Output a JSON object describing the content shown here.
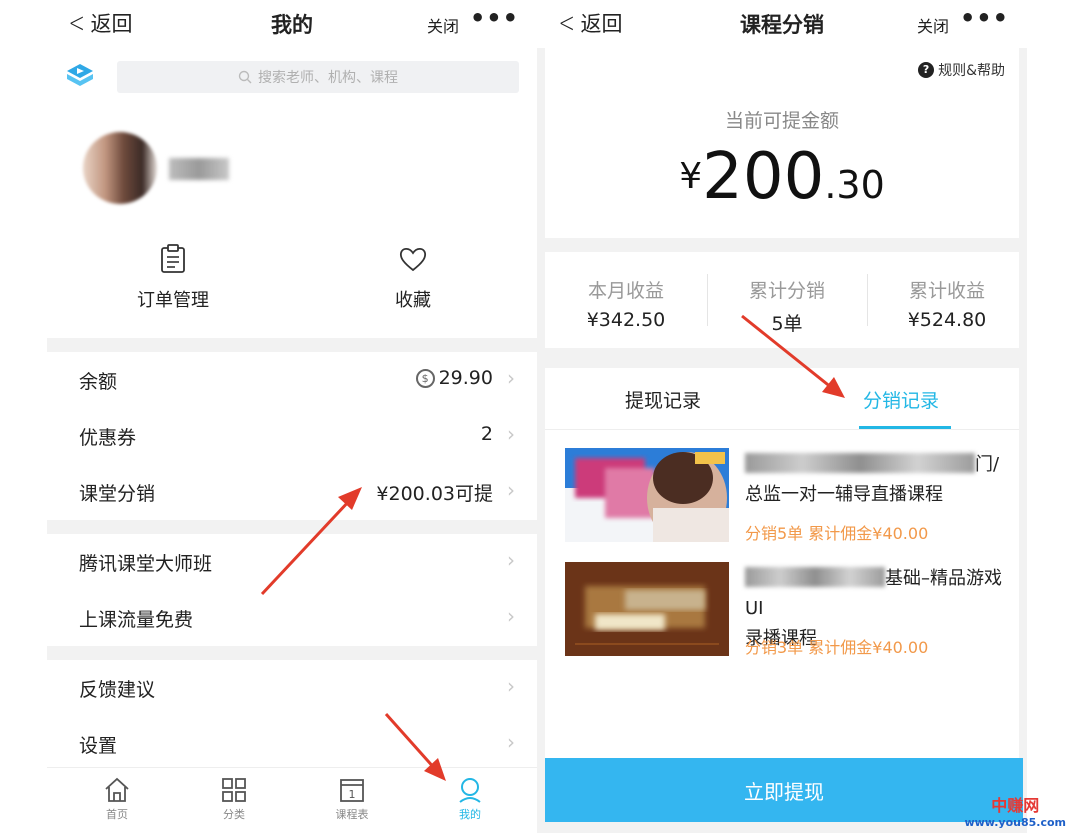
{
  "left": {
    "nav": {
      "back": "返回",
      "title": "我的",
      "close": "关闭",
      "more": "•••"
    },
    "search": {
      "placeholder": "搜索老师、机构、课程"
    },
    "quick": [
      {
        "label": "订单管理",
        "icon": "clipboard-icon"
      },
      {
        "label": "收藏",
        "icon": "heart-icon"
      }
    ],
    "rows": [
      {
        "label": "余额",
        "value": "29.90",
        "icon": "coin-icon"
      },
      {
        "label": "优惠券",
        "value": "2"
      },
      {
        "label": "课堂分销",
        "value": "¥200.03可提"
      },
      {
        "label": "腾讯课堂大师班",
        "value": ""
      },
      {
        "label": "上课流量免费",
        "value": ""
      },
      {
        "label": "反馈建议",
        "value": ""
      },
      {
        "label": "设置",
        "value": ""
      }
    ],
    "tabs": [
      {
        "label": "首页",
        "icon": "home-icon"
      },
      {
        "label": "分类",
        "icon": "grid-icon"
      },
      {
        "label": "课程表",
        "icon": "calendar-icon",
        "day": "1"
      },
      {
        "label": "我的",
        "icon": "user-icon",
        "active": true
      }
    ]
  },
  "right": {
    "nav": {
      "back": "返回",
      "title": "课程分销",
      "close": "关闭",
      "more": "•••"
    },
    "help": "规则&帮助",
    "balance": {
      "label": "当前可提金额",
      "currency": "¥",
      "integer": "200",
      "decimal": ".30"
    },
    "stats": [
      {
        "label": "本月收益",
        "value": "¥342.50"
      },
      {
        "label": "累计分销",
        "value": "5单"
      },
      {
        "label": "累计收益",
        "value": "¥524.80"
      }
    ],
    "tabs": [
      {
        "label": "提现记录",
        "active": false
      },
      {
        "label": "分销记录",
        "active": true
      }
    ],
    "courses": [
      {
        "title_tail": "门/",
        "title_line2": "总监一对一辅导直播课程",
        "meta": "分销5单  累计佣金¥40.00"
      },
      {
        "title_tail": "基础–精品游戏UI",
        "title_line2": "录播课程",
        "meta": "分销3单  累计佣金¥40.00"
      }
    ],
    "button": "立即提现"
  },
  "watermark": {
    "name": "中赚网",
    "url": "www.you85.com"
  },
  "colors": {
    "accent": "#23b7e5",
    "button": "#34b6f0",
    "meta": "#f2994a",
    "arrow": "#e23b2a"
  }
}
